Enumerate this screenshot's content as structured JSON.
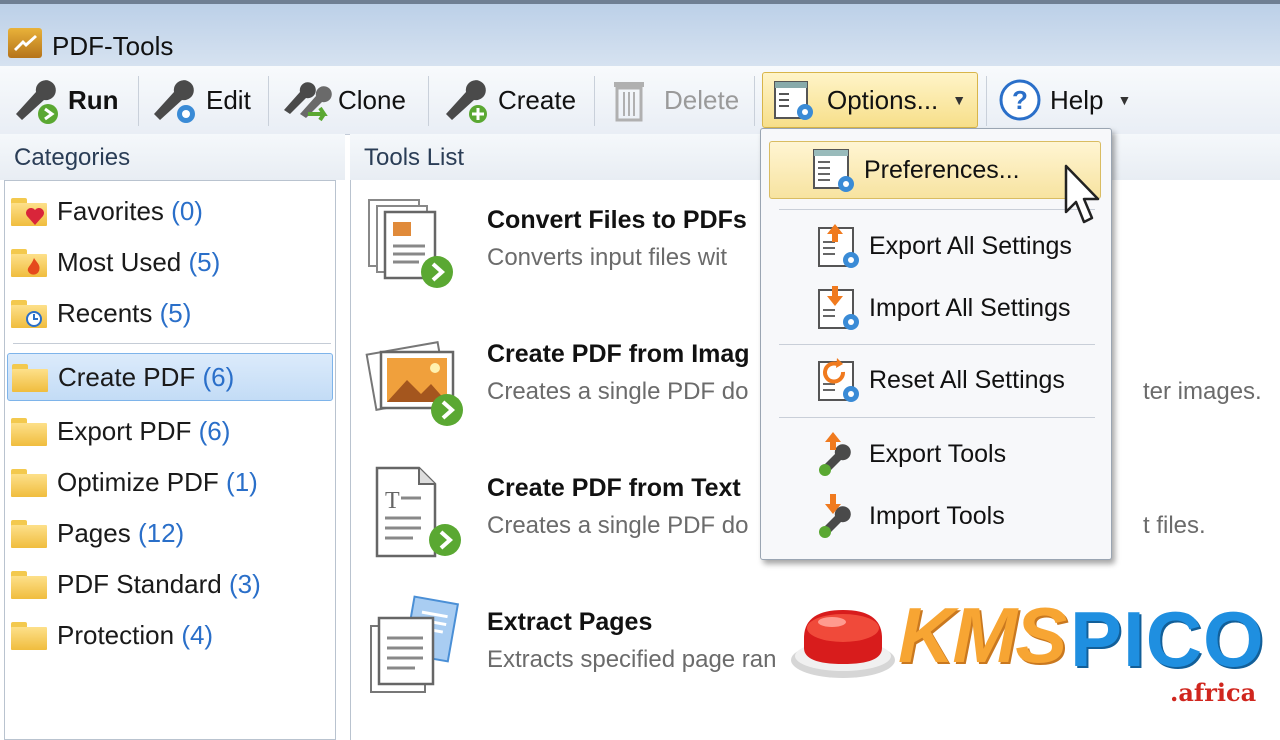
{
  "window": {
    "title": "PDF-Tools"
  },
  "toolbar": {
    "run": "Run",
    "edit": "Edit",
    "clone": "Clone",
    "create": "Create",
    "delete": "Delete",
    "options": "Options...",
    "help": "Help"
  },
  "categories": {
    "header": "Categories",
    "items": [
      {
        "label": "Favorites",
        "count": "(0)"
      },
      {
        "label": "Most Used",
        "count": "(5)"
      },
      {
        "label": "Recents",
        "count": "(5)"
      },
      {
        "label": "Create PDF",
        "count": "(6)"
      },
      {
        "label": "Export PDF",
        "count": "(6)"
      },
      {
        "label": "Optimize PDF",
        "count": "(1)"
      },
      {
        "label": "Pages",
        "count": "(12)"
      },
      {
        "label": "PDF Standard",
        "count": "(3)"
      },
      {
        "label": "Protection",
        "count": "(4)"
      }
    ],
    "selected": "Create PDF"
  },
  "tools": {
    "header": "Tools List",
    "items": [
      {
        "title": "Convert Files to PDFs",
        "desc": "Converts input files wit"
      },
      {
        "title": "Create PDF from Imag",
        "desc": "Creates a single PDF do",
        "desc_tail": "ter images."
      },
      {
        "title": "Create PDF from Text",
        "desc": "Creates a single PDF do",
        "desc_tail": "t files."
      },
      {
        "title": "Extract Pages",
        "desc": "Extracts specified page ran"
      }
    ]
  },
  "options_menu": {
    "items": [
      {
        "label": "Preferences...",
        "icon": "preferences-icon"
      },
      {
        "label": "Export All Settings",
        "icon": "export-settings-icon"
      },
      {
        "label": "Import All Settings",
        "icon": "import-settings-icon"
      },
      {
        "label": "Reset All Settings",
        "icon": "reset-settings-icon"
      },
      {
        "label": "Export Tools",
        "icon": "export-tools-icon"
      },
      {
        "label": "Import Tools",
        "icon": "import-tools-icon"
      }
    ],
    "hovered": "Preferences..."
  },
  "watermark": {
    "kms": "KMS",
    "pico": "PICO",
    "sub": ".africa"
  },
  "colors": {
    "accent": "#2a6fc9",
    "selection": "#c3dcf6",
    "menu_hover": "#f7e3a0",
    "brand_orange": "#f7a533",
    "brand_blue": "#1f8fe0"
  }
}
